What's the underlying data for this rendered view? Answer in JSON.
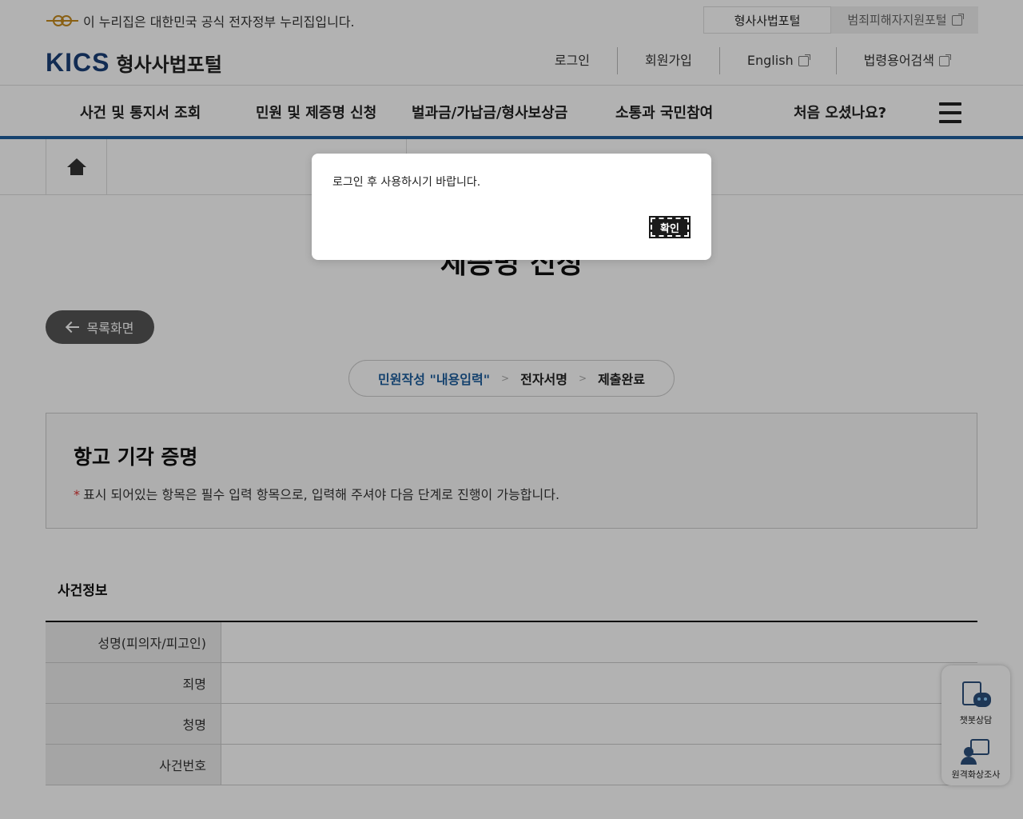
{
  "gov_bar": {
    "notice": "이 누리집은 대한민국 공식 전자정부 누리집입니다.",
    "tabs": [
      {
        "label": "형사사법포털",
        "active": true
      },
      {
        "label": "범죄피해자지원포털",
        "active": false,
        "external": true
      }
    ]
  },
  "header": {
    "logo_mark": "KICS",
    "site_name": "형사사법포털",
    "util_nav": [
      {
        "label": "로그인",
        "external": false
      },
      {
        "label": "회원가입",
        "external": false
      },
      {
        "label": "English",
        "external": true
      },
      {
        "label": "법령용어검색",
        "external": true
      }
    ]
  },
  "gnb": {
    "items": [
      "사건 및 통지서 조회",
      "민원 및 제증명 신청",
      "벌과금/가납금/형사보상금",
      "소통과 국민참여",
      "처음 오셨나요?"
    ],
    "menu_icon": "hamburger-icon"
  },
  "breadcrumb": {
    "home_icon": "home-icon"
  },
  "page": {
    "title": "제증명 신청",
    "back_label": "목록화면"
  },
  "steps": [
    {
      "label": "민원작성 \"내용입력\"",
      "active": true
    },
    {
      "label": "전자서명",
      "active": false
    },
    {
      "label": "제출완료",
      "active": false
    }
  ],
  "form": {
    "title": "항고 기각 증명",
    "required_mark": "*",
    "note": "표시 되어있는 항목은 필수 입력 항목으로, 입력해 주셔야 다음 단계로 진행이 가능합니다."
  },
  "case_info": {
    "section_title": "사건정보",
    "rows": [
      {
        "label": "성명(피의자/피고인)",
        "value": ""
      },
      {
        "label": "죄명",
        "value": ""
      },
      {
        "label": "청명",
        "value": ""
      },
      {
        "label": "사건번호",
        "value": ""
      }
    ]
  },
  "quick_menu": {
    "items": [
      {
        "label": "챗봇상담",
        "icon": "chatbot-icon"
      },
      {
        "label": "원격화상조사",
        "icon": "video-investigation-icon"
      }
    ]
  },
  "dialog": {
    "message": "로그인 후 사용하시기 바랍니다.",
    "ok_label": "확인"
  },
  "colors": {
    "accent": "#1f5f9e",
    "brand": "#1a3f78",
    "back_button": "#555555",
    "dialog_button": "#1a1a1a",
    "overlay": "rgba(0,0,0,0.3)"
  }
}
